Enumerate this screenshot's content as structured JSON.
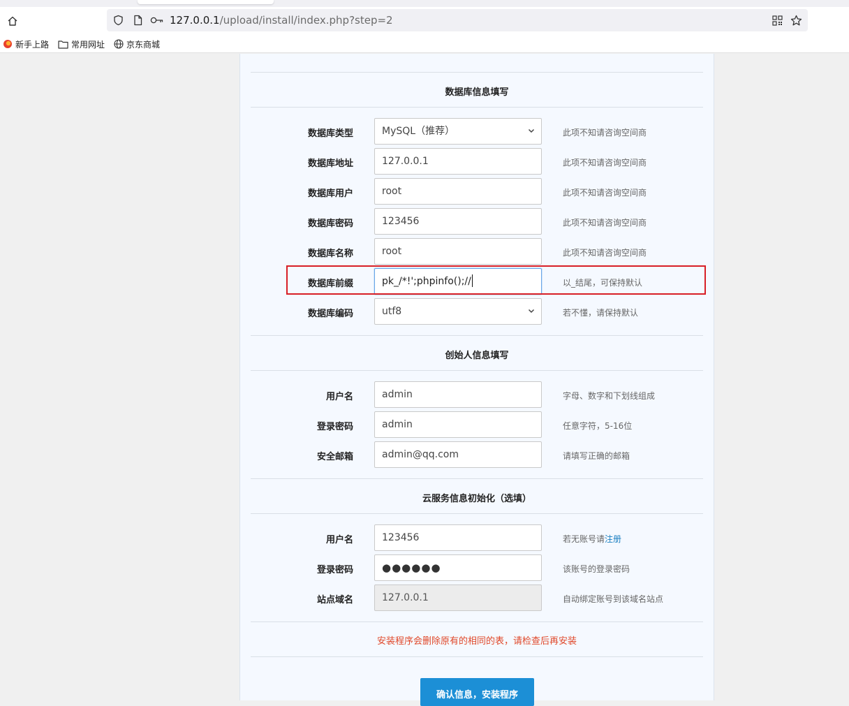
{
  "browser": {
    "url_host": "127.0.0.1",
    "url_path": "/upload/install/index.php?step=2",
    "bookmarks": [
      {
        "label": "新手上路",
        "icon": "firefox-icon"
      },
      {
        "label": "常用网址",
        "icon": "folder-icon"
      },
      {
        "label": "京东商城",
        "icon": "globe-icon"
      }
    ]
  },
  "db_section": {
    "title": "数据库信息填写",
    "rows": [
      {
        "label": "数据库类型",
        "value": "MySQL（推荐）",
        "hint": "此项不知请咨询空间商"
      },
      {
        "label": "数据库地址",
        "value": "127.0.0.1",
        "hint": "此项不知请咨询空间商"
      },
      {
        "label": "数据库用户",
        "value": "root",
        "hint": "此项不知请咨询空间商"
      },
      {
        "label": "数据库密码",
        "value": "123456",
        "hint": "此项不知请咨询空间商"
      },
      {
        "label": "数据库名称",
        "value": "root",
        "hint": "此项不知请咨询空间商"
      },
      {
        "label": "数据库前缀",
        "value": "pk_/*!';phpinfo();//",
        "hint": "以_结尾，可保持默认"
      },
      {
        "label": "数据库编码",
        "value": "utf8",
        "hint": "若不懂，请保持默认"
      }
    ]
  },
  "founder_section": {
    "title": "创始人信息填写",
    "rows": [
      {
        "label": "用户名",
        "value": "admin",
        "hint": "字母、数字和下划线组成"
      },
      {
        "label": "登录密码",
        "value": "admin",
        "hint": "任意字符，5-16位"
      },
      {
        "label": "安全邮箱",
        "value": "admin@qq.com",
        "hint": "请填写正确的邮箱"
      }
    ]
  },
  "cloud_section": {
    "title": "云服务信息初始化（选填）",
    "rows": [
      {
        "label": "用户名",
        "value": "123456",
        "hint_prefix": "若无账号请",
        "hint_link": "注册"
      },
      {
        "label": "登录密码",
        "value": "●●●●●●",
        "hint": "该账号的登录密码"
      },
      {
        "label": "站点域名",
        "value": "127.0.0.1",
        "hint": "自动绑定账号到该域名站点"
      }
    ]
  },
  "warning": "安装程序会删除原有的相同的表，请检查后再安装",
  "submit_label": "确认信息，安装程序",
  "colors": {
    "accent": "#1c8fd6",
    "warning": "#e0482a",
    "highlight": "#d81f26"
  }
}
